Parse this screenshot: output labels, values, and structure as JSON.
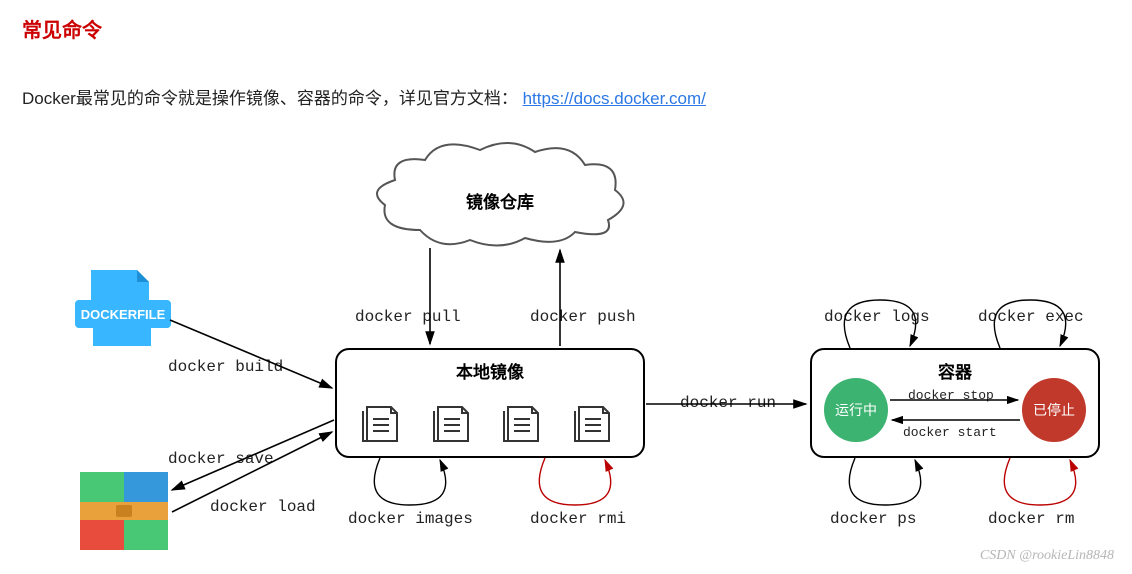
{
  "title": "常见命令",
  "subtitle_prefix": "Docker最常见的命令就是操作镜像、容器的命令，详见官方文档：",
  "subtitle_link": "https://docs.docker.com/",
  "cloud_label": "镜像仓库",
  "dockerfile_label": "DOCKERFILE",
  "local_box_title": "本地镜像",
  "container_box_title": "容器",
  "state_running": "运行中",
  "state_stopped": "已停止",
  "cmds": {
    "pull": "docker pull",
    "push": "docker push",
    "build": "docker build",
    "save": "docker save",
    "load": "docker load",
    "images": "docker images",
    "rmi": "docker rmi",
    "run": "docker run",
    "logs": "docker logs",
    "exec": "docker exec",
    "stop": "docker stop",
    "start": "docker start",
    "ps": "docker ps",
    "rm": "docker rm"
  },
  "watermark": "CSDN @rookieLin8848"
}
